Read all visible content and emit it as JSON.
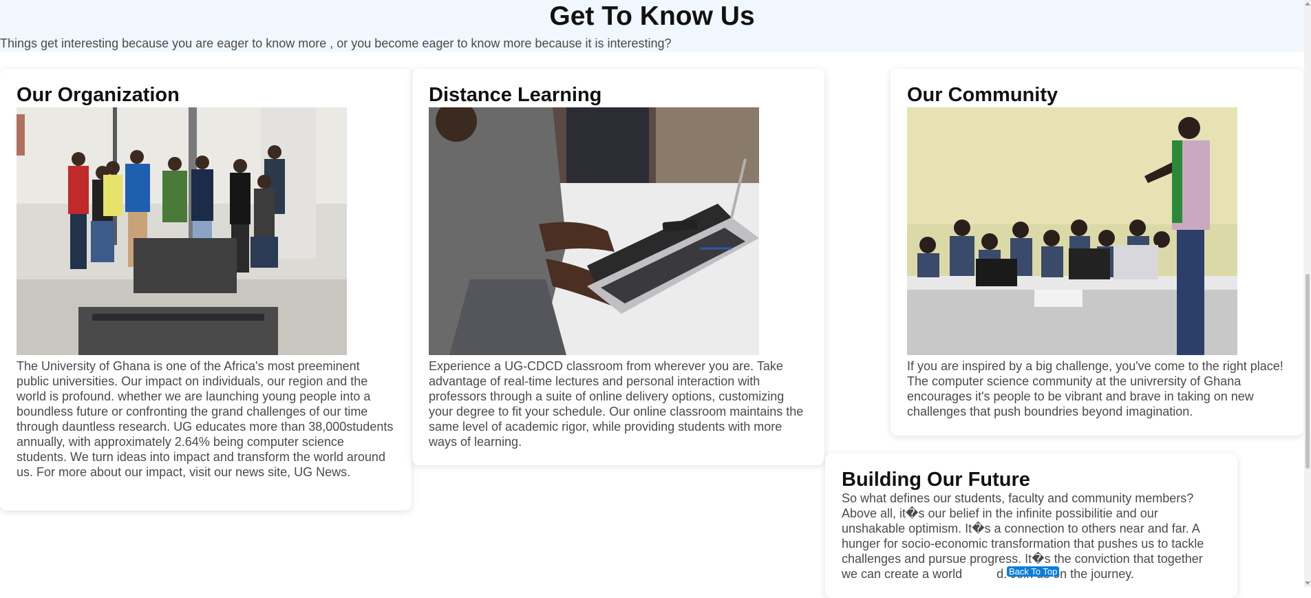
{
  "header": {
    "title": "Get To Know Us",
    "subtitle": "Things get interesting because you are eager to know more , or you become eager to know more because it is interesting?"
  },
  "cards": [
    {
      "title": "Our Organization",
      "image": "group-photo-students",
      "text": "The University of Ghana is one of the Africa's most preeminent public universities. Our impact on individuals, our region and the world is profound. whether we are launching young people into a boundless future or confronting the grand challenges of our time through dauntless research. UG educates more than 38,000students annually, with approximately 2.64% being computer science students. We turn ideas into impact and transform the world around us. For more about our impact, visit our news site, UG News."
    },
    {
      "title": "Distance Learning",
      "image": "laptop-typing-photo",
      "text": "Experience a UG-CDCD classroom from wherever you are. Take advantage of real-time lectures and personal interaction with professors through a suite of online delivery options, customizing your degree to fit your schedule. Our online classroom maintains the same level of academic rigor, while providing students with more ways of learning."
    },
    {
      "title": "Our Community",
      "image": "classroom-lecture-photo",
      "text": "If you are inspired by a big challenge, you've come to the right place! The computer science community at the univrersity of Ghana encourages it's people to be vibrant and brave in taking on new challenges that push boundries beyond imagination."
    },
    {
      "title": "Building Our Future",
      "text": "So what defines our students, faculty and community members? Above all, it�s our belief in the infinite possibilitie and our unshakable optimism. It�s a connection to others near and far. A hunger for socio-economic transformation that pushes us to tackle challenges and pursue progress. It�s the conviction that together we can create a world          d. Join us on the journey."
    }
  ],
  "back_to_top": "Back To Top",
  "colors": {
    "header_bg": "#f0f7ff",
    "button_bg": "#0b7dda"
  }
}
